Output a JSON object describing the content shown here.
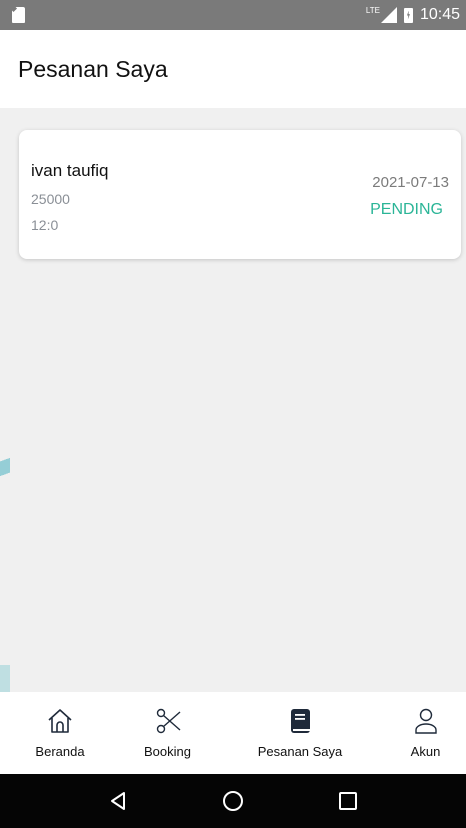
{
  "status_bar": {
    "network": "LTE",
    "time": "10:45"
  },
  "header": {
    "title": "Pesanan Saya"
  },
  "orders": [
    {
      "name": "ivan taufiq",
      "price": "25000",
      "time": "12:0",
      "date": "2021-07-13",
      "status": "PENDING"
    }
  ],
  "colors": {
    "status_pending": "#2bb597",
    "active_nav_icon": "#1f2a3a"
  },
  "bottom_nav": {
    "items": [
      {
        "label": "Beranda",
        "icon": "home-icon",
        "active": false
      },
      {
        "label": "Booking",
        "icon": "scissors-icon",
        "active": false
      },
      {
        "label": "Pesanan Saya",
        "icon": "book-icon",
        "active": true
      },
      {
        "label": "Akun",
        "icon": "user-icon",
        "active": false
      }
    ]
  },
  "system_nav": {
    "buttons": [
      "back-icon",
      "home-circle-icon",
      "recents-icon"
    ]
  }
}
